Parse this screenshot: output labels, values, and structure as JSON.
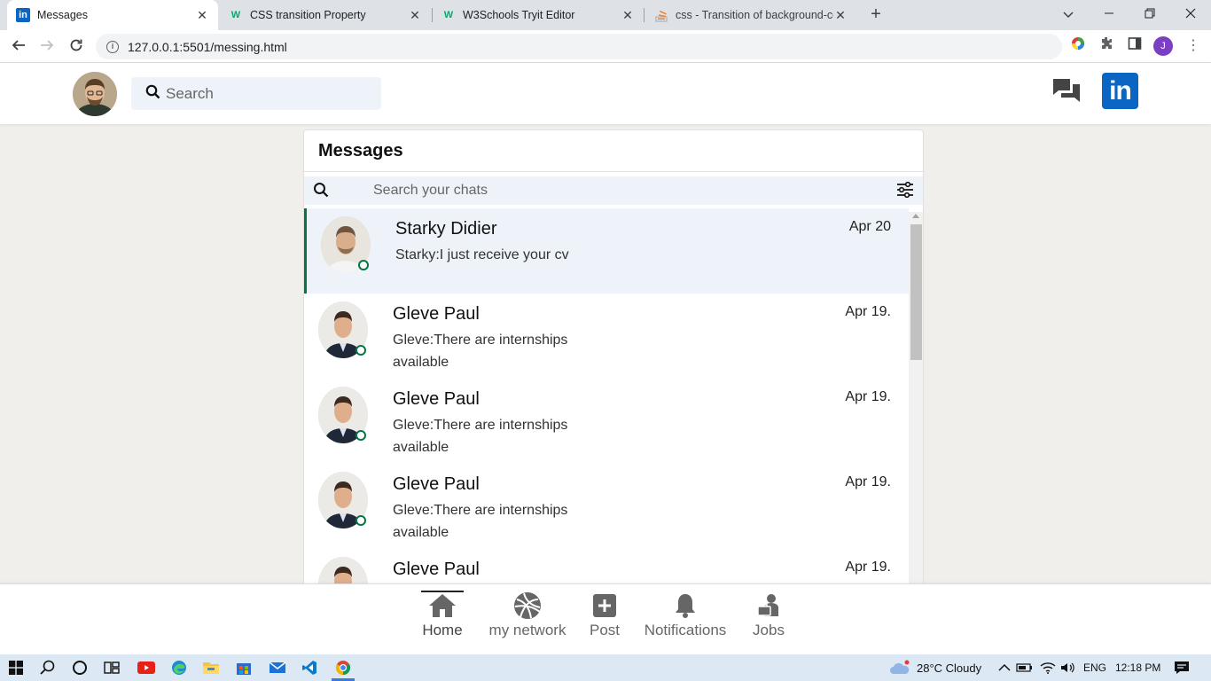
{
  "browser": {
    "tabs": [
      {
        "title": "Messages",
        "icon": "linkedin-favicon"
      },
      {
        "title": "CSS transition Property",
        "icon": "w3schools-favicon"
      },
      {
        "title": "W3Schools Tryit Editor",
        "icon": "w3schools-favicon"
      },
      {
        "title": "css - Transition of background-co",
        "icon": "stackoverflow-favicon"
      }
    ],
    "url": "127.0.0.1:5501/messing.html",
    "profile_initial": "J"
  },
  "header": {
    "search_placeholder": "Search",
    "logo_text": "in"
  },
  "messages": {
    "title": "Messages",
    "search_placeholder": "Search your chats",
    "conversations": [
      {
        "name": "Starky Didier",
        "snippet": "Starky:I just receive your cv",
        "date": "Apr 20",
        "online": true,
        "selected": true
      },
      {
        "name": "Gleve Paul",
        "snippet": "Gleve:There are internships available",
        "date": "Apr 19.",
        "online": true,
        "selected": false
      },
      {
        "name": "Gleve Paul",
        "snippet": "Gleve:There are internships available",
        "date": "Apr 19.",
        "online": true,
        "selected": false
      },
      {
        "name": "Gleve Paul",
        "snippet": "Gleve:There are internships available",
        "date": "Apr 19.",
        "online": true,
        "selected": false
      },
      {
        "name": "Gleve Paul",
        "snippet": "",
        "date": "Apr 19.",
        "online": true,
        "selected": false
      }
    ]
  },
  "bottom_nav": {
    "items": [
      {
        "label": "Home",
        "icon": "home-icon"
      },
      {
        "label": "my network",
        "icon": "network-icon"
      },
      {
        "label": "Post",
        "icon": "post-icon"
      },
      {
        "label": "Notifications",
        "icon": "bell-icon"
      },
      {
        "label": "Jobs",
        "icon": "jobs-icon"
      }
    ]
  },
  "taskbar": {
    "weather": "28°C  Cloudy",
    "language": "ENG",
    "time": "12:18 PM"
  },
  "colors": {
    "accent": "#0a66c2",
    "online": "#057642",
    "selected_bg": "#edf3f8"
  }
}
